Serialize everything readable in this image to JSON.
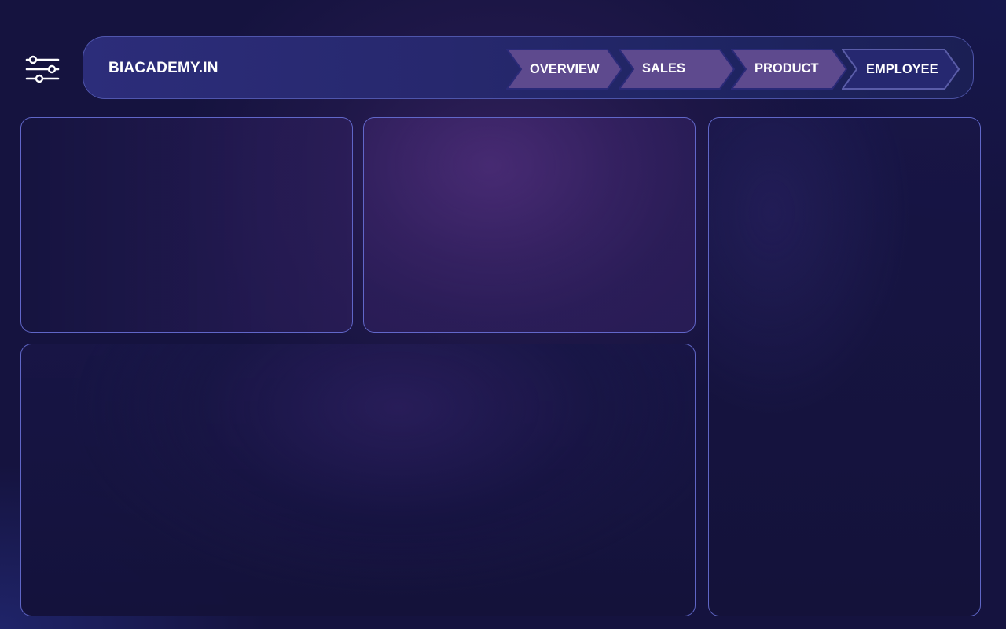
{
  "brand": {
    "name": "BIACADEMY.IN"
  },
  "filter_icon": "sliders-icon",
  "nav": {
    "tabs": [
      {
        "label": "OVERVIEW",
        "active": false
      },
      {
        "label": "SALES",
        "active": false
      },
      {
        "label": "PRODUCT",
        "active": false
      },
      {
        "label": "EMPLOYEE",
        "active": true
      }
    ]
  },
  "colors": {
    "background": "#15133f",
    "header": "#2c2d7a",
    "tab_inactive": "#5e4a8e",
    "tab_active": "#262870",
    "panel_border": "#6870d6",
    "text": "#ffffff"
  }
}
